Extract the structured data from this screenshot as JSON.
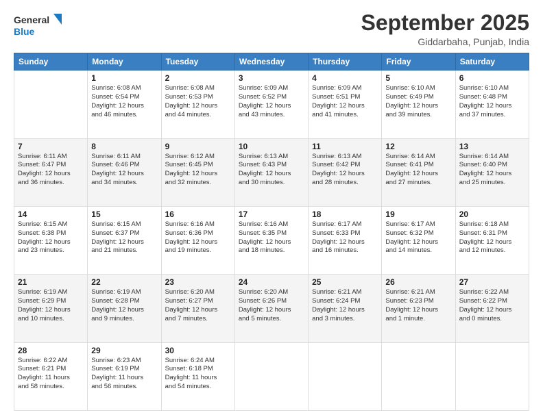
{
  "logo": {
    "line1": "General",
    "line2": "Blue"
  },
  "title": "September 2025",
  "subtitle": "Giddarbaha, Punjab, India",
  "weekdays": [
    "Sunday",
    "Monday",
    "Tuesday",
    "Wednesday",
    "Thursday",
    "Friday",
    "Saturday"
  ],
  "weeks": [
    [
      {
        "day": "",
        "info": ""
      },
      {
        "day": "1",
        "info": "Sunrise: 6:08 AM\nSunset: 6:54 PM\nDaylight: 12 hours\nand 46 minutes."
      },
      {
        "day": "2",
        "info": "Sunrise: 6:08 AM\nSunset: 6:53 PM\nDaylight: 12 hours\nand 44 minutes."
      },
      {
        "day": "3",
        "info": "Sunrise: 6:09 AM\nSunset: 6:52 PM\nDaylight: 12 hours\nand 43 minutes."
      },
      {
        "day": "4",
        "info": "Sunrise: 6:09 AM\nSunset: 6:51 PM\nDaylight: 12 hours\nand 41 minutes."
      },
      {
        "day": "5",
        "info": "Sunrise: 6:10 AM\nSunset: 6:49 PM\nDaylight: 12 hours\nand 39 minutes."
      },
      {
        "day": "6",
        "info": "Sunrise: 6:10 AM\nSunset: 6:48 PM\nDaylight: 12 hours\nand 37 minutes."
      }
    ],
    [
      {
        "day": "7",
        "info": "Sunrise: 6:11 AM\nSunset: 6:47 PM\nDaylight: 12 hours\nand 36 minutes."
      },
      {
        "day": "8",
        "info": "Sunrise: 6:11 AM\nSunset: 6:46 PM\nDaylight: 12 hours\nand 34 minutes."
      },
      {
        "day": "9",
        "info": "Sunrise: 6:12 AM\nSunset: 6:45 PM\nDaylight: 12 hours\nand 32 minutes."
      },
      {
        "day": "10",
        "info": "Sunrise: 6:13 AM\nSunset: 6:43 PM\nDaylight: 12 hours\nand 30 minutes."
      },
      {
        "day": "11",
        "info": "Sunrise: 6:13 AM\nSunset: 6:42 PM\nDaylight: 12 hours\nand 28 minutes."
      },
      {
        "day": "12",
        "info": "Sunrise: 6:14 AM\nSunset: 6:41 PM\nDaylight: 12 hours\nand 27 minutes."
      },
      {
        "day": "13",
        "info": "Sunrise: 6:14 AM\nSunset: 6:40 PM\nDaylight: 12 hours\nand 25 minutes."
      }
    ],
    [
      {
        "day": "14",
        "info": "Sunrise: 6:15 AM\nSunset: 6:38 PM\nDaylight: 12 hours\nand 23 minutes."
      },
      {
        "day": "15",
        "info": "Sunrise: 6:15 AM\nSunset: 6:37 PM\nDaylight: 12 hours\nand 21 minutes."
      },
      {
        "day": "16",
        "info": "Sunrise: 6:16 AM\nSunset: 6:36 PM\nDaylight: 12 hours\nand 19 minutes."
      },
      {
        "day": "17",
        "info": "Sunrise: 6:16 AM\nSunset: 6:35 PM\nDaylight: 12 hours\nand 18 minutes."
      },
      {
        "day": "18",
        "info": "Sunrise: 6:17 AM\nSunset: 6:33 PM\nDaylight: 12 hours\nand 16 minutes."
      },
      {
        "day": "19",
        "info": "Sunrise: 6:17 AM\nSunset: 6:32 PM\nDaylight: 12 hours\nand 14 minutes."
      },
      {
        "day": "20",
        "info": "Sunrise: 6:18 AM\nSunset: 6:31 PM\nDaylight: 12 hours\nand 12 minutes."
      }
    ],
    [
      {
        "day": "21",
        "info": "Sunrise: 6:19 AM\nSunset: 6:29 PM\nDaylight: 12 hours\nand 10 minutes."
      },
      {
        "day": "22",
        "info": "Sunrise: 6:19 AM\nSunset: 6:28 PM\nDaylight: 12 hours\nand 9 minutes."
      },
      {
        "day": "23",
        "info": "Sunrise: 6:20 AM\nSunset: 6:27 PM\nDaylight: 12 hours\nand 7 minutes."
      },
      {
        "day": "24",
        "info": "Sunrise: 6:20 AM\nSunset: 6:26 PM\nDaylight: 12 hours\nand 5 minutes."
      },
      {
        "day": "25",
        "info": "Sunrise: 6:21 AM\nSunset: 6:24 PM\nDaylight: 12 hours\nand 3 minutes."
      },
      {
        "day": "26",
        "info": "Sunrise: 6:21 AM\nSunset: 6:23 PM\nDaylight: 12 hours\nand 1 minute."
      },
      {
        "day": "27",
        "info": "Sunrise: 6:22 AM\nSunset: 6:22 PM\nDaylight: 12 hours\nand 0 minutes."
      }
    ],
    [
      {
        "day": "28",
        "info": "Sunrise: 6:22 AM\nSunset: 6:21 PM\nDaylight: 11 hours\nand 58 minutes."
      },
      {
        "day": "29",
        "info": "Sunrise: 6:23 AM\nSunset: 6:19 PM\nDaylight: 11 hours\nand 56 minutes."
      },
      {
        "day": "30",
        "info": "Sunrise: 6:24 AM\nSunset: 6:18 PM\nDaylight: 11 hours\nand 54 minutes."
      },
      {
        "day": "",
        "info": ""
      },
      {
        "day": "",
        "info": ""
      },
      {
        "day": "",
        "info": ""
      },
      {
        "day": "",
        "info": ""
      }
    ]
  ]
}
